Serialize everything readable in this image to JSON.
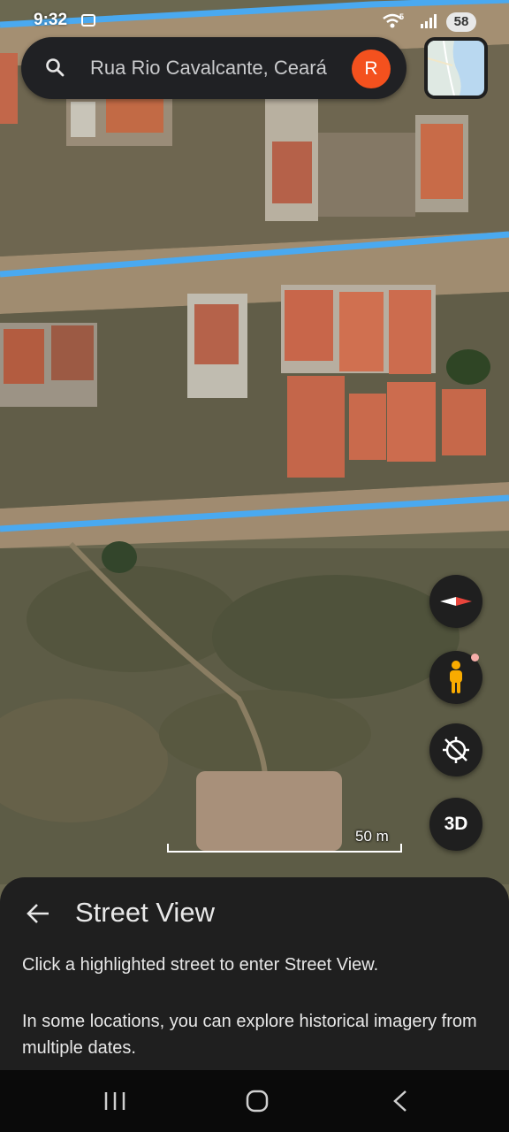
{
  "status": {
    "time": "9:32",
    "wifi_label": "5",
    "battery": "58"
  },
  "search": {
    "text": "Rua Rio Cavalcante, Ceará",
    "avatar_letter": "R"
  },
  "map": {
    "scale_label": "50 m",
    "road_color": "#4aa9f0"
  },
  "controls": {
    "three_d_label": "3D",
    "icons": [
      "compass-icon",
      "pegman-icon",
      "location-disabled-icon"
    ]
  },
  "sheet": {
    "title": "Street View",
    "line1": "Click a highlighted street to enter Street View.",
    "line2": "In some locations, you can explore historical imagery from multiple dates."
  },
  "nav": {
    "icons": [
      "recent-apps-icon",
      "home-icon",
      "back-icon"
    ]
  }
}
